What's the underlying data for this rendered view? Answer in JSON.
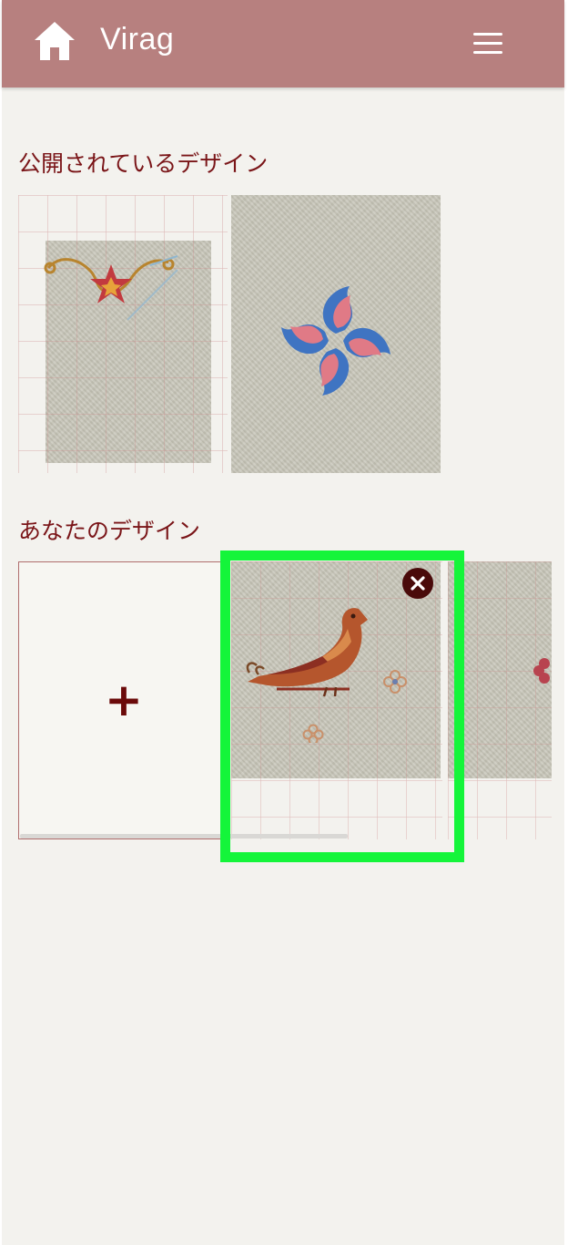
{
  "header": {
    "title": "Virag",
    "home_icon": "home-icon",
    "menu_icon": "hamburger-menu-icon",
    "background_color": "#b7807f"
  },
  "public_designs": {
    "title": "公開されているデザイン",
    "items": [
      {
        "name": "Star ornament embroidery design"
      },
      {
        "name": "Blue tulip pinwheel embroidery design"
      }
    ]
  },
  "your_designs": {
    "title": "あなたのデザイン",
    "add_label": "+",
    "items": [
      {
        "name": "Bird embroidery design",
        "selected": true,
        "remove_icon": "close-icon"
      },
      {
        "name": "Flower embroidery design (partially visible)"
      }
    ]
  },
  "colors": {
    "accent": "#7a1518",
    "highlight": "#14f53a",
    "page_background": "#f3f2ee"
  }
}
